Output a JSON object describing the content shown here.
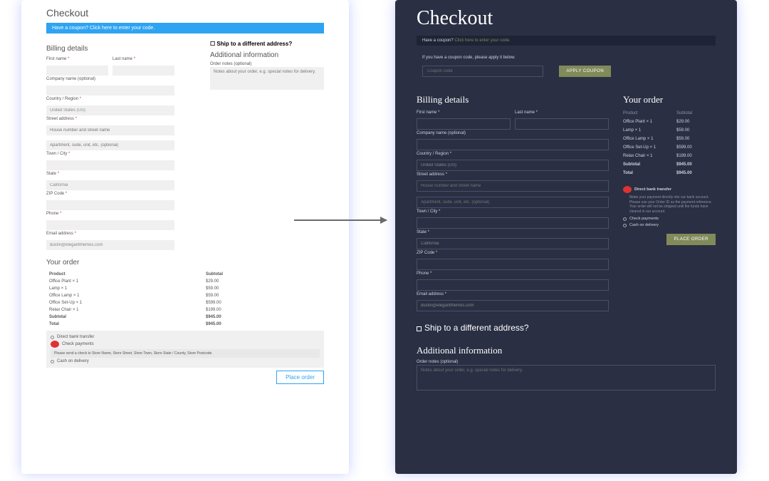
{
  "left": {
    "title": "Checkout",
    "coupon_bar": "Have a coupon? Click here to enter your code.",
    "billing_h": "Billing details",
    "fn": "First name",
    "ln": "Last name",
    "company": "Company name (optional)",
    "country": "Country / Region",
    "country_val": "United States (US)",
    "street": "Street address",
    "street_ph1": "House number and street name",
    "street_ph2": "Apartment, suite, unit, etc. (optional)",
    "town": "Town / City",
    "state": "State",
    "state_val": "California",
    "zip": "ZIP Code",
    "phone": "Phone",
    "email": "Email address",
    "email_val": "dustin@elegantthemes.com",
    "ship_h": "Ship to a different address?",
    "add_h": "Additional information",
    "notes_lbl": "Order notes (optional)",
    "notes_ph": "Notes about your order, e.g. special notes for delivery.",
    "order_h": "Your order",
    "cols": {
      "p": "Product",
      "s": "Subtotal"
    },
    "items": [
      {
        "n": "Office Plant",
        "q": "× 1",
        "p": "$29.00"
      },
      {
        "n": "Lamp",
        "q": "× 1",
        "p": "$59.00"
      },
      {
        "n": "Office Lamp",
        "q": "× 1",
        "p": "$59.00"
      },
      {
        "n": "Office Set-Up",
        "q": "× 1",
        "p": "$599.00"
      },
      {
        "n": "Relax Chair",
        "q": "× 1",
        "p": "$199.00"
      }
    ],
    "subtotal_l": "Subtotal",
    "subtotal_v": "$945.00",
    "total_l": "Total",
    "total_v": "$945.00",
    "pay1": "Direct bank transfer",
    "pay2": "Check payments",
    "pay2_note": "Please send a check to Store Name, Store Street, Store Town, Store State / County, Store Postcode.",
    "pay3": "Cash on delivery",
    "place": "Place order"
  },
  "right": {
    "title": "Checkout",
    "coupon_q": "Have a coupon?",
    "coupon_l": "Click here to enter your code.",
    "coupon_t": "If you have a coupon code, please apply it below.",
    "coupon_ph": "Coupon code",
    "apply": "APPLY COUPON",
    "billing_h": "Billing details",
    "fn": "First name *",
    "ln": "Last name *",
    "company": "Company name (optional)",
    "country": "Country / Region *",
    "country_val": "United States (US)",
    "street": "Street address *",
    "street_ph1": "House number and street name",
    "street_ph2": "Apartment, suite, unit, etc. (optional)",
    "town": "Town / City *",
    "state": "State *",
    "state_val": "California",
    "zip": "ZIP Code *",
    "phone": "Phone *",
    "email": "Email address *",
    "email_val": "dustin@elegantthemes.com",
    "order_h": "Your order",
    "cols": {
      "p": "Product",
      "s": "Subtotal"
    },
    "items": [
      {
        "n": "Office Plant  × 1",
        "p": "$29.00"
      },
      {
        "n": "Lamp  × 1",
        "p": "$59.00"
      },
      {
        "n": "Office Lamp  × 1",
        "p": "$59.00"
      },
      {
        "n": "Office Set-Up  × 1",
        "p": "$599.00"
      },
      {
        "n": "Relax Chair  × 1",
        "p": "$199.00"
      }
    ],
    "subtotal_l": "Subtotal",
    "subtotal_v": "$945.00",
    "total_l": "Total",
    "total_v": "$945.00",
    "pay1": "Direct bank transfer",
    "pay1_note": "Make your payment directly into our bank account. Please use your Order ID as the payment reference. Your order will not be shipped until the funds have cleared in our account.",
    "pay2": "Check payments",
    "pay3": "Cash on delivery",
    "place": "PLACE ORDER",
    "ship_h": "Ship to a different address?",
    "add_h": "Additional information",
    "notes_lbl": "Order notes (optional)",
    "notes_ph": "Notes about your order, e.g. special notes for delivery."
  }
}
